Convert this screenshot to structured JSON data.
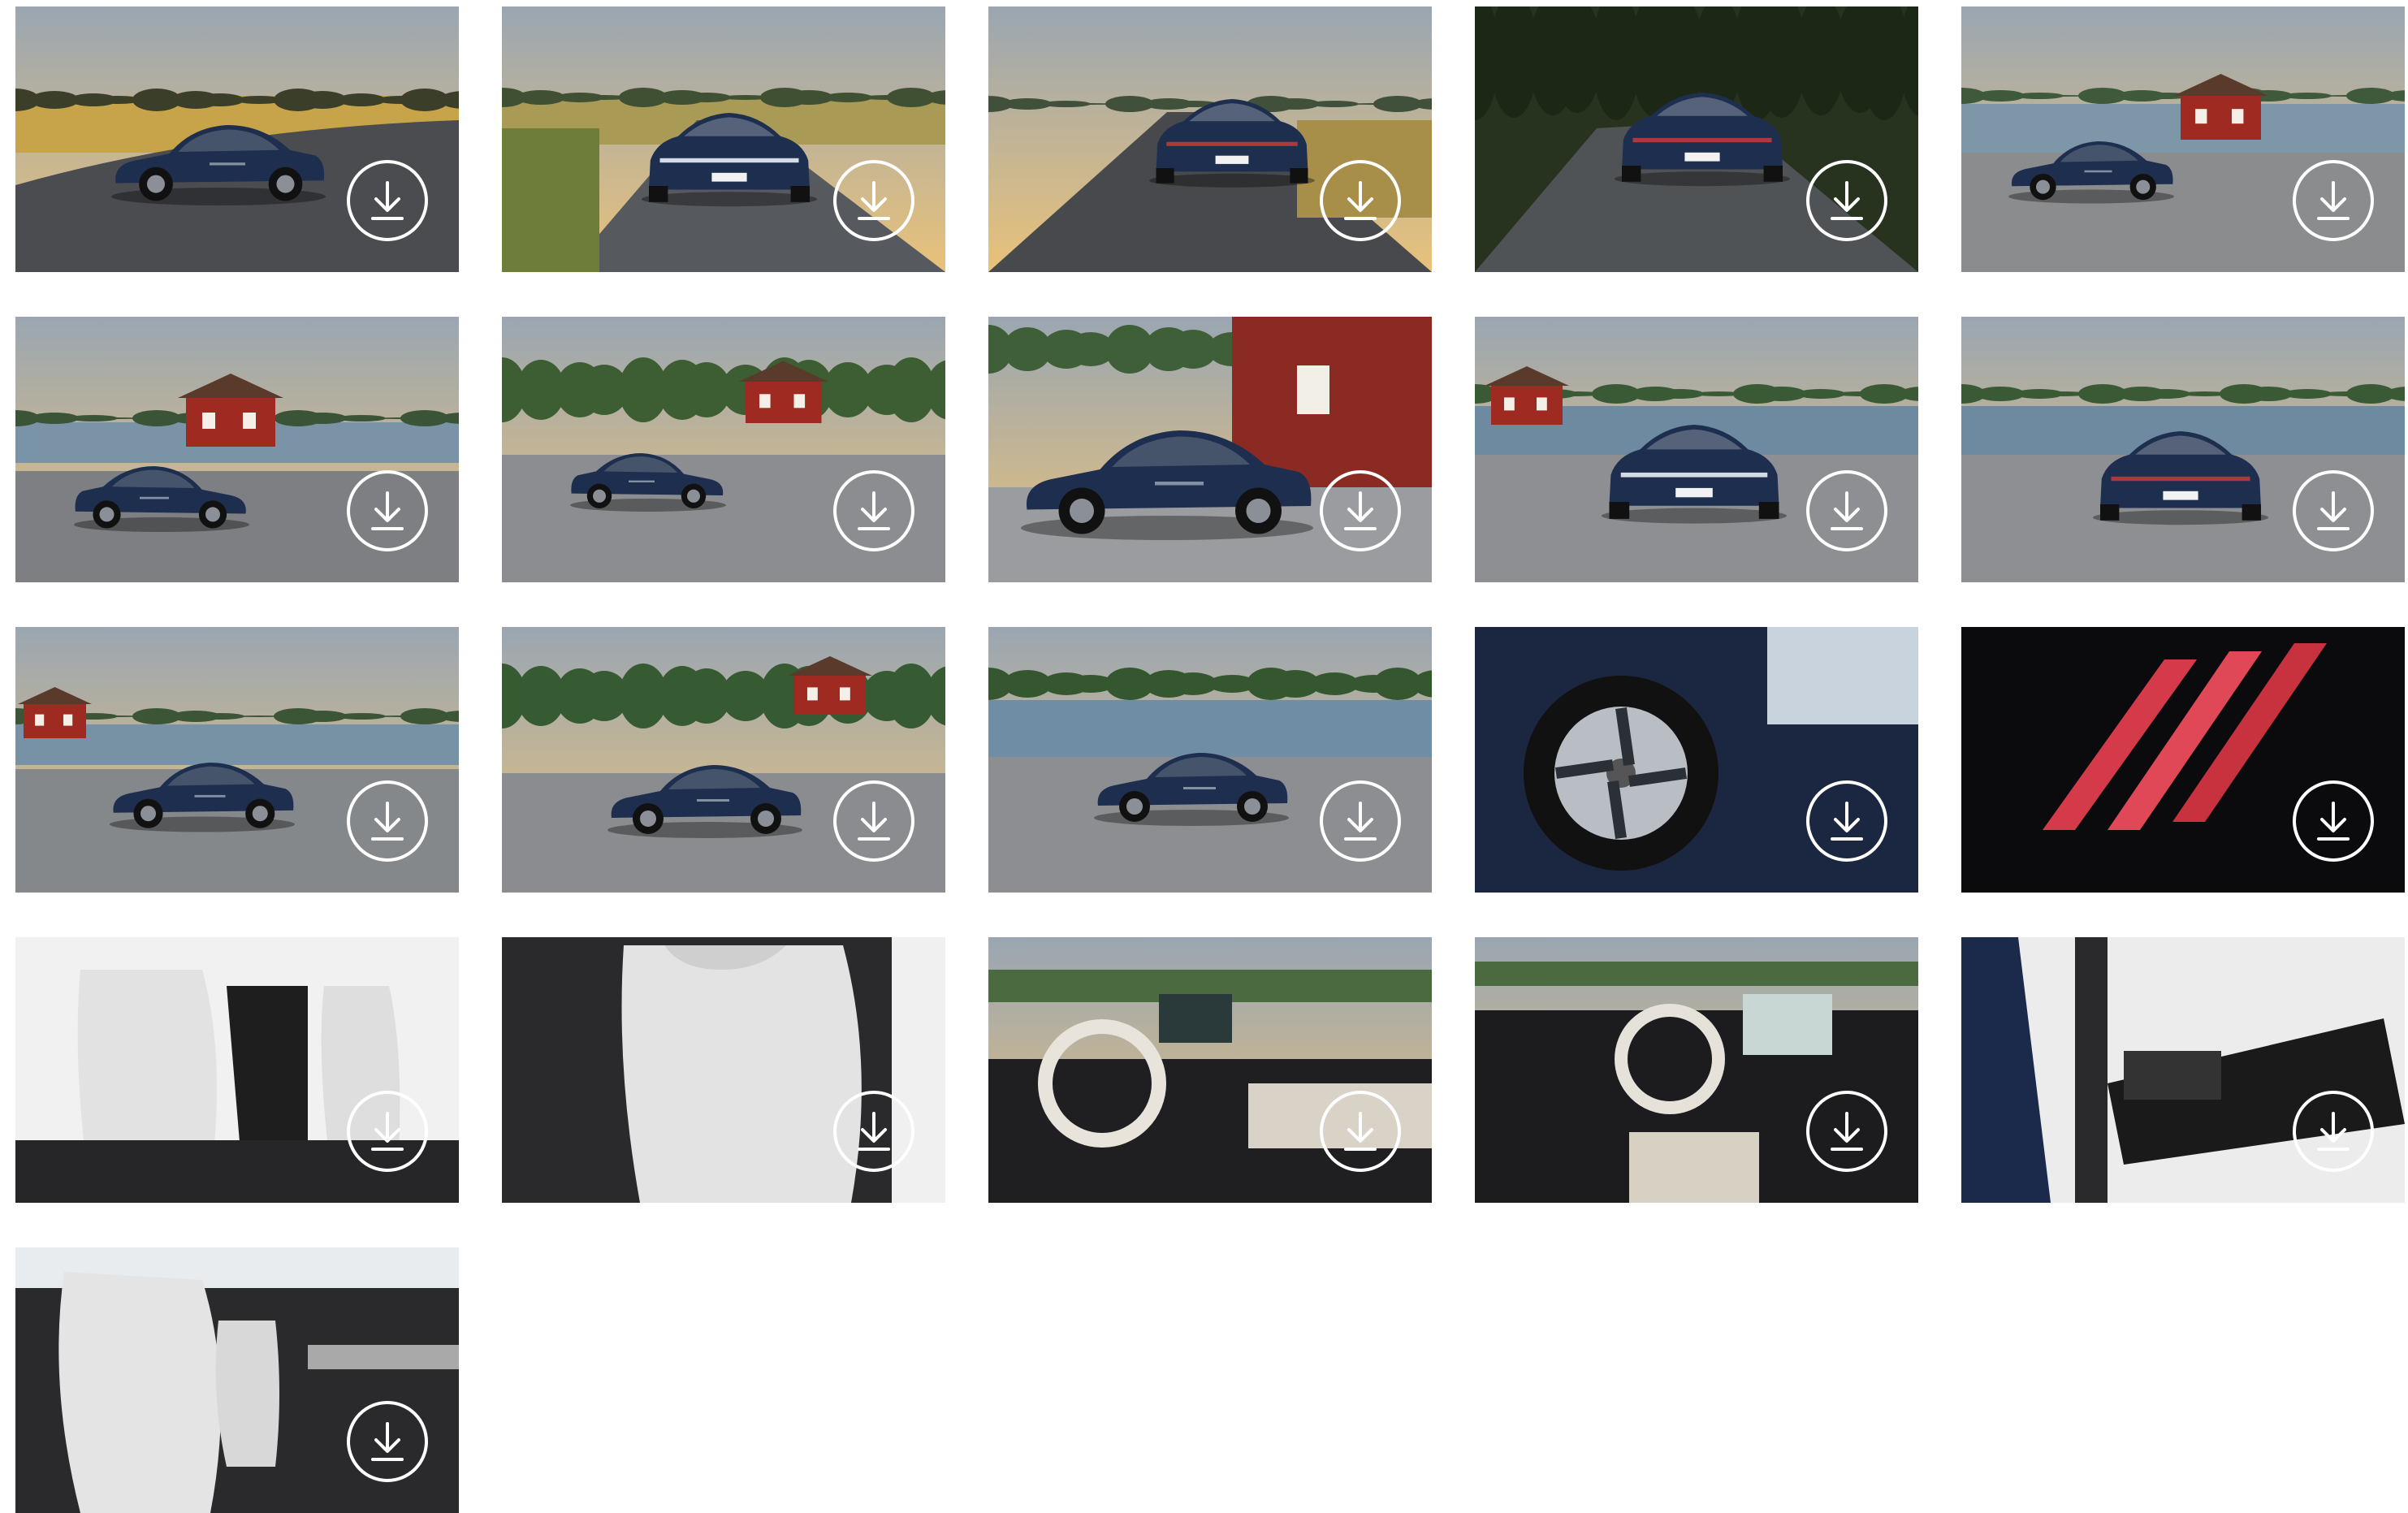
{
  "gallery": {
    "download_icon": "download-arrow-icon",
    "items": [
      {
        "scene": "sunset-road-front",
        "icon": "download-arrow-icon"
      },
      {
        "scene": "road-front-approach",
        "icon": "download-arrow-icon"
      },
      {
        "scene": "road-rear",
        "icon": "download-arrow-icon"
      },
      {
        "scene": "forest-road-rear",
        "icon": "download-arrow-icon"
      },
      {
        "scene": "lake-red-house-front",
        "icon": "download-arrow-icon"
      },
      {
        "scene": "lake-red-house-rear",
        "icon": "download-arrow-icon"
      },
      {
        "scene": "village-side-rear",
        "icon": "download-arrow-icon"
      },
      {
        "scene": "front-detail-red-house",
        "icon": "download-arrow-icon"
      },
      {
        "scene": "harbor-front",
        "icon": "download-arrow-icon"
      },
      {
        "scene": "harbor-rear",
        "icon": "download-arrow-icon"
      },
      {
        "scene": "shore-front-three-quarter",
        "icon": "download-arrow-icon"
      },
      {
        "scene": "village-side-profile",
        "icon": "download-arrow-icon"
      },
      {
        "scene": "lakeside-front-three-quarter",
        "icon": "download-arrow-icon"
      },
      {
        "scene": "wheel-detail",
        "icon": "download-arrow-icon"
      },
      {
        "scene": "rear-light-detail",
        "icon": "download-arrow-icon"
      },
      {
        "scene": "rear-seats-interior",
        "icon": "download-arrow-icon"
      },
      {
        "scene": "front-seat-detail",
        "icon": "download-arrow-icon"
      },
      {
        "scene": "cockpit-side-view",
        "icon": "download-arrow-icon"
      },
      {
        "scene": "cockpit-center-view",
        "icon": "download-arrow-icon"
      },
      {
        "scene": "door-speaker-detail",
        "icon": "download-arrow-icon"
      },
      {
        "scene": "front-seats-interior",
        "icon": "download-arrow-icon"
      }
    ]
  },
  "colors": {
    "page_background": "#ffffff",
    "icon_stroke": "#ffffff",
    "car_body": "#1d2e4f"
  }
}
